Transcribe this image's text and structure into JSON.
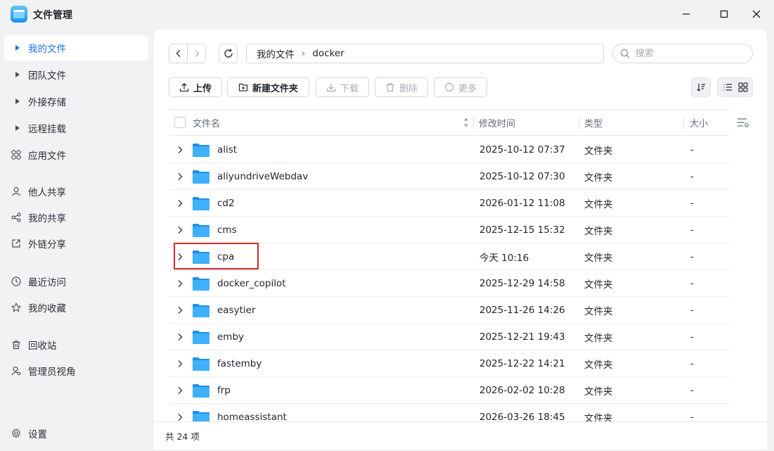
{
  "window": {
    "title": "文件管理",
    "minimize": "─",
    "maximize": "☐",
    "close": "✕"
  },
  "sidebar": {
    "items": [
      {
        "label": "我的文件",
        "icon": "caret-right-icon",
        "active": true
      },
      {
        "label": "团队文件",
        "icon": "caret-right-icon"
      },
      {
        "label": "外接存储",
        "icon": "caret-right-icon"
      },
      {
        "label": "远程挂载",
        "icon": "caret-right-icon"
      },
      {
        "label": "应用文件",
        "icon": "apps-icon"
      },
      {
        "label": "他人共享",
        "icon": "user-share-icon"
      },
      {
        "label": "我的共享",
        "icon": "share-icon"
      },
      {
        "label": "外链分享",
        "icon": "external-link-icon"
      },
      {
        "label": "最近访问",
        "icon": "clock-icon"
      },
      {
        "label": "我的收藏",
        "icon": "star-icon"
      },
      {
        "label": "回收站",
        "icon": "trash-icon"
      },
      {
        "label": "管理员视角",
        "icon": "admin-icon"
      }
    ],
    "settings_label": "设置"
  },
  "toolbar": {
    "path": [
      "我的文件",
      "docker"
    ],
    "path_sep": "›",
    "search_placeholder": "搜索",
    "upload": "上传",
    "new_folder": "新建文件夹",
    "download": "下载",
    "delete": "删除",
    "more": "更多"
  },
  "table": {
    "headers": {
      "name": "文件名",
      "mtime": "修改时间",
      "type": "类型",
      "size": "大小"
    },
    "rows": [
      {
        "name": "alist",
        "mtime": "2025-10-12 07:37",
        "type": "文件夹",
        "size": "-"
      },
      {
        "name": "aliyundriveWebdav",
        "mtime": "2025-10-12 07:30",
        "type": "文件夹",
        "size": "-"
      },
      {
        "name": "cd2",
        "mtime": "2026-01-12 11:08",
        "type": "文件夹",
        "size": "-"
      },
      {
        "name": "cms",
        "mtime": "2025-12-15 15:32",
        "type": "文件夹",
        "size": "-"
      },
      {
        "name": "cpa",
        "mtime": "今天 10:16",
        "type": "文件夹",
        "size": "-",
        "highlighted": true
      },
      {
        "name": "docker_copilot",
        "mtime": "2025-12-29 14:58",
        "type": "文件夹",
        "size": "-"
      },
      {
        "name": "easytier",
        "mtime": "2025-11-26 14:26",
        "type": "文件夹",
        "size": "-"
      },
      {
        "name": "emby",
        "mtime": "2025-12-21 19:43",
        "type": "文件夹",
        "size": "-"
      },
      {
        "name": "fastemby",
        "mtime": "2025-12-22 14:21",
        "type": "文件夹",
        "size": "-"
      },
      {
        "name": "frp",
        "mtime": "2026-02-02 10:28",
        "type": "文件夹",
        "size": "-"
      },
      {
        "name": "homeassistant",
        "mtime": "2026-03-26 18:45",
        "type": "文件夹",
        "size": "-"
      }
    ]
  },
  "footer": {
    "count": "共 24 项"
  },
  "colors": {
    "accent": "#1a73e8",
    "highlight": "#d9252b",
    "folder": "#2ea3f7"
  }
}
